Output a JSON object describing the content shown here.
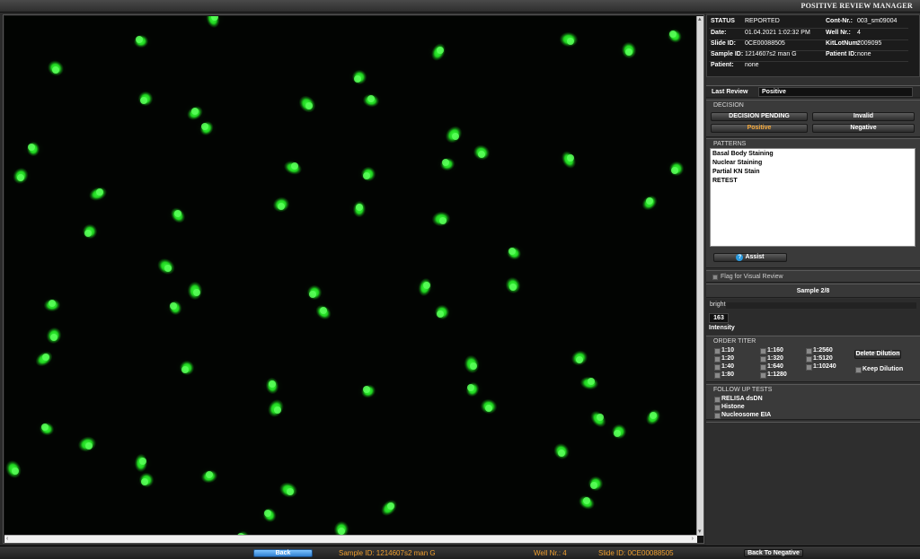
{
  "app": {
    "title": "POSITIVE REVIEW MANAGER"
  },
  "info": {
    "rows": [
      {
        "label": "STATUS",
        "value": "REPORTED",
        "label2": "Cont-Nr.:",
        "value2": "003_sm09004"
      },
      {
        "label": "Date:",
        "value": "01.04.2021  1:02:32 PM",
        "label2": "Well Nr.:",
        "value2": "4"
      },
      {
        "label": "Slide ID:",
        "value": "0CE00088505",
        "label2": "KitLotNum:",
        "value2": "2009095"
      },
      {
        "label": "Sample ID:",
        "value": "1214607s2 man G",
        "label2": "Patient ID:",
        "value2": "none"
      },
      {
        "label": "Patient:",
        "value": "none",
        "label2": "",
        "value2": ""
      }
    ]
  },
  "last_review": {
    "label": "Last Review",
    "value": "Positive"
  },
  "decision": {
    "title": "DECISION",
    "pending": "DECISION PENDING",
    "invalid": "Invalid",
    "positive": "Positive",
    "negative": "Negative"
  },
  "patterns": {
    "title": "PATTERNS",
    "items": [
      "Basal Body Staining",
      "Nuclear Staining",
      "Partial KN Stain",
      "RETEST"
    ],
    "assist_label": "Assist"
  },
  "flag": {
    "label": "Flag for Visual Review"
  },
  "sample": {
    "label": "Sample 2/8"
  },
  "brightness": {
    "label": "bright",
    "intensity_value": "163",
    "intensity_label": "Intensity"
  },
  "order_titer": {
    "title": "ORDER TITER",
    "col1": [
      "1:10",
      "1:20",
      "1:40",
      "1:80"
    ],
    "col2": [
      "1:160",
      "1:320",
      "1:640",
      "1:1280"
    ],
    "col3": [
      "1:2560",
      "1:5120",
      "1:10240"
    ],
    "delete_label": "Delete Dilution",
    "keep_label": "Keep Dilution"
  },
  "followup": {
    "title": "FOLLOW UP TESTS",
    "items": [
      "RELISA dsDN",
      "Histone",
      "Nucleosome EIA"
    ]
  },
  "footer": {
    "back_label": "Back",
    "sample_id": "Sample ID: 1214607s2 man G",
    "well_nr": "Well Nr.: 4",
    "slide_id": "Slide ID: 0CE00088505",
    "back_to_negative": "Back To Negative"
  },
  "colors": {
    "accent": "#f4a83a",
    "fluorescence": "#2ee82e",
    "back_button": "#4aa3f0"
  },
  "icons": {
    "assist": "question-icon",
    "scroll_left": "arrow-left-icon",
    "scroll_right": "arrow-right-icon"
  }
}
